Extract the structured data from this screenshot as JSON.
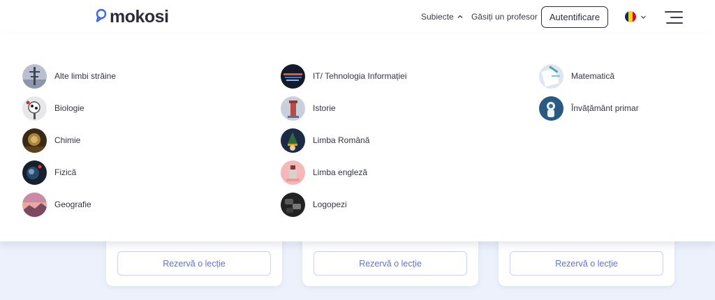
{
  "header": {
    "logo_text": "mokosi",
    "nav_subjects": "Subiecte",
    "nav_find_tutor": "Găsiți un profesor",
    "login_button": "Autentificare",
    "language_flag_colors": [
      "#002b7f",
      "#fcd116",
      "#ce1126"
    ],
    "icons": {
      "logo": "pin-ring-icon",
      "subjects_chevron": "chevron-up-icon",
      "language_chevron": "chevron-down-icon",
      "menu": "hamburger-menu-icon"
    }
  },
  "dropdown": {
    "columns": [
      [
        {
          "label": "Alte limbi străine"
        },
        {
          "label": "Biologie"
        },
        {
          "label": "Chimie"
        },
        {
          "label": "Fizică"
        },
        {
          "label": "Geografie"
        }
      ],
      [
        {
          "label": "IT/ Tehnologia Informației"
        },
        {
          "label": "Istorie"
        },
        {
          "label": "Limba Română"
        },
        {
          "label": "Limba engleză"
        },
        {
          "label": "Logopezi"
        }
      ],
      [
        {
          "label": "Matematică"
        },
        {
          "label": "Învățământ primar"
        }
      ]
    ]
  },
  "cards": [
    {
      "button": "Rezervă o lecție"
    },
    {
      "button": "Rezervă o lecție"
    },
    {
      "button": "Rezervă o lecție"
    }
  ],
  "colors": {
    "brand_blue": "#3b63ff",
    "button_text": "#5b72e0",
    "page_background": "#edf1fb"
  }
}
